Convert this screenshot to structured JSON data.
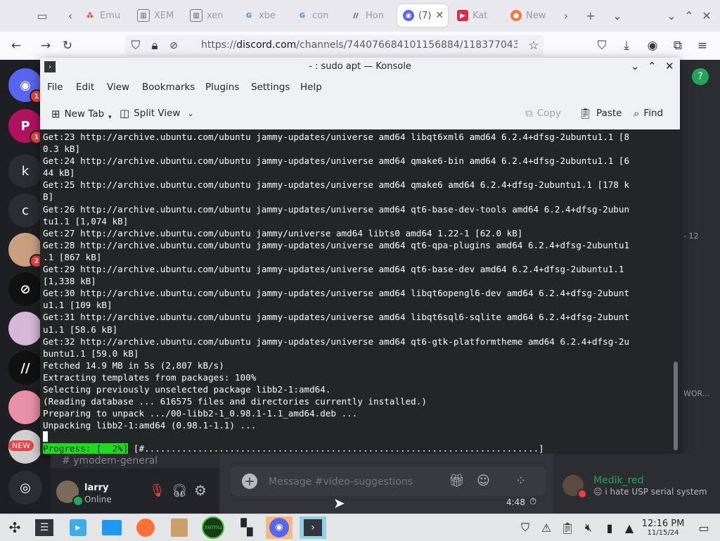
{
  "browser": {
    "tabs": [
      {
        "label": "Emu",
        "favicon": "grid-icon"
      },
      {
        "label": "XEM",
        "favicon": "building-icon"
      },
      {
        "label": "xen",
        "favicon": "building-icon"
      },
      {
        "label": "xbe",
        "favicon": "google-icon"
      },
      {
        "label": "con",
        "favicon": "google-icon"
      },
      {
        "label": "Hon",
        "favicon": "slash-icon"
      },
      {
        "label": "(7)",
        "favicon": "discord-tab-icon",
        "active": true
      },
      {
        "label": "Kat",
        "favicon": "youtube-icon"
      },
      {
        "label": "New",
        "favicon": "firefox-icon"
      }
    ],
    "url_prefix": "https://",
    "url_domain": "discord.com",
    "url_path": "/channels/744076684101156884/118377043291",
    "colors": {
      "accent": "#5865f2",
      "discord_bg": "#313338"
    }
  },
  "konsole": {
    "title": "- : sudo apt — Konsole",
    "menu": [
      "File",
      "Edit",
      "View",
      "Bookmarks",
      "Plugins",
      "Settings",
      "Help"
    ],
    "toolbar": {
      "new_tab": "New Tab",
      "split_view": "Split View",
      "copy": "Copy",
      "paste": "Paste",
      "find": "Find"
    },
    "terminal_lines": [
      "Get:23 http://archive.ubuntu.com/ubuntu jammy-updates/universe amd64 libqt6xml6 amd64 6.2.4+dfsg-2ubuntu1.1 [8",
      "0.3 kB]",
      "Get:24 http://archive.ubuntu.com/ubuntu jammy-updates/universe amd64 qmake6-bin amd64 6.2.4+dfsg-2ubuntu1.1 [6",
      "44 kB]",
      "Get:25 http://archive.ubuntu.com/ubuntu jammy-updates/universe amd64 qmake6 amd64 6.2.4+dfsg-2ubuntu1.1 [178 k",
      "B]",
      "Get:26 http://archive.ubuntu.com/ubuntu jammy-updates/universe amd64 qt6-base-dev-tools amd64 6.2.4+dfsg-2ubun",
      "tu1.1 [1,074 kB]",
      "Get:27 http://archive.ubuntu.com/ubuntu jammy/universe amd64 libts0 amd64 1.22-1 [62.0 kB]",
      "Get:28 http://archive.ubuntu.com/ubuntu jammy-updates/universe amd64 qt6-qpa-plugins amd64 6.2.4+dfsg-2ubuntu1",
      ".1 [867 kB]",
      "Get:29 http://archive.ubuntu.com/ubuntu jammy-updates/universe amd64 qt6-base-dev amd64 6.2.4+dfsg-2ubuntu1.1",
      "[1,338 kB]",
      "Get:30 http://archive.ubuntu.com/ubuntu jammy-updates/universe amd64 libqt6opengl6-dev amd64 6.2.4+dfsg-2ubunt",
      "u1.1 [109 kB]",
      "Get:31 http://archive.ubuntu.com/ubuntu jammy-updates/universe amd64 libqt6sql6-sqlite amd64 6.2.4+dfsg-2ubunt",
      "u1.1 [58.6 kB]",
      "Get:32 http://archive.ubuntu.com/ubuntu jammy-updates/universe amd64 qt6-gtk-platformtheme amd64 6.2.4+dfsg-2u",
      "buntu1.1 [59.0 kB]",
      "Fetched 14.9 MB in 5s (2,807 kB/s)",
      "Extracting templates from packages: 100%",
      "Selecting previously unselected package libb2-1:amd64.",
      "(Reading database ... 616575 files and directories currently installed.)",
      "Preparing to unpack .../00-libb2-1_0.98.1-1.1_amd64.deb ...",
      "Unpacking libb2-1:amd64 (0.98.1-1.1) ..."
    ],
    "progress_label": "Progress: [  2%]",
    "progress_bar": "[#..........................................................................]",
    "progress_percent": 2
  },
  "discord": {
    "servers": [
      {
        "letter": "",
        "icon": "discord-home-icon",
        "badge": "1"
      },
      {
        "letter": "P",
        "icon": "p-server-icon",
        "badge": "1"
      },
      {
        "letter": "k",
        "icon": "",
        "badge": ""
      },
      {
        "letter": "c",
        "icon": "",
        "badge": ""
      },
      {
        "letter": "",
        "icon": "avatar-server-icon",
        "badge": "2"
      },
      {
        "letter": "",
        "icon": "slashed-logo-icon",
        "badge": ""
      },
      {
        "letter": "",
        "icon": "anime-server-icon",
        "badge": ""
      },
      {
        "letter": "",
        "icon": "slash-server-icon",
        "badge": ""
      },
      {
        "letter": "",
        "icon": "anime-server-icon",
        "badge": ""
      },
      {
        "letter": "",
        "icon": "new-server-icon",
        "badge": ""
      }
    ],
    "new_label": "NEW",
    "channel_hint": "# ymodem-general",
    "side_count": "- 12",
    "side_label": "WOR...",
    "user": {
      "name": "larry",
      "status": "Online"
    },
    "message_placeholder": "Message #video-suggestions",
    "time_overlay": "4:48",
    "member": {
      "name": "Medik_red",
      "status": "i hate USP serial system"
    }
  },
  "taskbar": {
    "apps": [
      "start-icon",
      "settings-icon",
      "discover-icon",
      "files-icon",
      "firefox-icon",
      "archive-icon",
      "xemu-icon",
      "blocks-icon",
      "discord-icon",
      "konsole-icon"
    ],
    "xemu_label": "xemu",
    "clock_time": "12:16 PM",
    "clock_date": "11/15/24"
  }
}
